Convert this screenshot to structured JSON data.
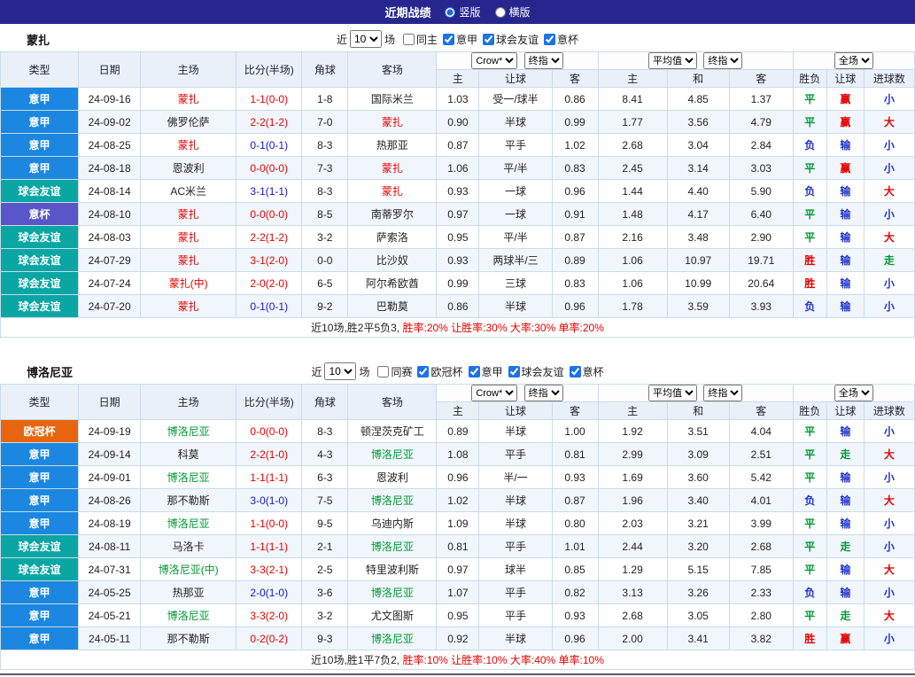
{
  "header": {
    "title": "近期战绩",
    "modes": [
      {
        "label": "竖版",
        "selected": true
      },
      {
        "label": "横版",
        "selected": false
      }
    ]
  },
  "table_headers": {
    "col_type": "类型",
    "col_date": "日期",
    "col_home": "主场",
    "col_score": "比分(半场)",
    "col_corner": "角球",
    "col_away": "客场",
    "col_h": "主",
    "col_handicap": "让球",
    "col_a": "客",
    "col_avg_h": "主",
    "col_avg_d": "和",
    "col_avg_a": "客",
    "col_wdl": "胜负",
    "col_hcp_result": "让球",
    "col_goals": "进球数"
  },
  "type_colors": {
    "意甲": "#1b87e0",
    "球会友谊": "#09a6a3",
    "意杯": "#5a55c8",
    "欧冠杯": "#e8650f"
  },
  "team_colors": {
    "red": "#e80000",
    "green": "#009933",
    "black": "#222222",
    "blue": "#1515cc"
  },
  "result_colors": {
    "胜": "#e80000",
    "赢": "#e80000",
    "大": "#e80000",
    "平": "#009933",
    "走": "#009933",
    "负": "#2233cc",
    "输": "#2233cc",
    "小": "#2233cc"
  },
  "sections": [
    {
      "team": "蒙扎",
      "filter": {
        "prefix": "近",
        "count": "10",
        "suffix": "场",
        "checkboxes": [
          {
            "label": "同主",
            "checked": false
          },
          {
            "label": "意甲",
            "checked": true
          },
          {
            "label": "球会友谊",
            "checked": true
          },
          {
            "label": "意杯",
            "checked": true
          }
        ]
      },
      "selects": {
        "source": "Crow*",
        "final1": "终指",
        "avg": "平均值",
        "final2": "终指",
        "scope": "全场"
      },
      "rows": [
        {
          "type": "意甲",
          "date": "24-09-16",
          "home": "蒙扎",
          "home_c": "red",
          "score": "1-1(0-0)",
          "score_c": "red",
          "corner": "1-8",
          "away": "国际米兰",
          "away_c": "black",
          "o1": "1.03",
          "hcp": "受一/球半",
          "o2": "0.86",
          "a1": "8.41",
          "a2": "4.85",
          "a3": "1.37",
          "r1": "平",
          "r2": "赢",
          "r3": "小"
        },
        {
          "type": "意甲",
          "date": "24-09-02",
          "home": "佛罗伦萨",
          "home_c": "black",
          "score": "2-2(1-2)",
          "score_c": "red",
          "corner": "7-0",
          "away": "蒙扎",
          "away_c": "red",
          "o1": "0.90",
          "hcp": "半球",
          "o2": "0.99",
          "a1": "1.77",
          "a2": "3.56",
          "a3": "4.79",
          "r1": "平",
          "r2": "赢",
          "r3": "大"
        },
        {
          "type": "意甲",
          "date": "24-08-25",
          "home": "蒙扎",
          "home_c": "red",
          "score": "0-1(0-1)",
          "score_c": "blue",
          "corner": "8-3",
          "away": "热那亚",
          "away_c": "black",
          "o1": "0.87",
          "hcp": "平手",
          "o2": "1.02",
          "a1": "2.68",
          "a2": "3.04",
          "a3": "2.84",
          "r1": "负",
          "r2": "输",
          "r3": "小"
        },
        {
          "type": "意甲",
          "date": "24-08-18",
          "home": "恩波利",
          "home_c": "black",
          "score": "0-0(0-0)",
          "score_c": "red",
          "corner": "7-3",
          "away": "蒙扎",
          "away_c": "red",
          "o1": "1.06",
          "hcp": "平/半",
          "o2": "0.83",
          "a1": "2.45",
          "a2": "3.14",
          "a3": "3.03",
          "r1": "平",
          "r2": "赢",
          "r3": "小"
        },
        {
          "type": "球会友谊",
          "date": "24-08-14",
          "home": "AC米兰",
          "home_c": "black",
          "score": "3-1(1-1)",
          "score_c": "blue",
          "corner": "8-3",
          "away": "蒙扎",
          "away_c": "red",
          "o1": "0.93",
          "hcp": "一球",
          "o2": "0.96",
          "a1": "1.44",
          "a2": "4.40",
          "a3": "5.90",
          "r1": "负",
          "r2": "输",
          "r3": "大"
        },
        {
          "type": "意杯",
          "date": "24-08-10",
          "home": "蒙扎",
          "home_c": "red",
          "score": "0-0(0-0)",
          "score_c": "red",
          "corner": "8-5",
          "away": "南蒂罗尔",
          "away_c": "black",
          "o1": "0.97",
          "hcp": "一球",
          "o2": "0.91",
          "a1": "1.48",
          "a2": "4.17",
          "a3": "6.40",
          "r1": "平",
          "r2": "输",
          "r3": "小"
        },
        {
          "type": "球会友谊",
          "date": "24-08-03",
          "home": "蒙扎",
          "home_c": "red",
          "score": "2-2(1-2)",
          "score_c": "red",
          "corner": "3-2",
          "away": "萨索洛",
          "away_c": "black",
          "o1": "0.95",
          "hcp": "平/半",
          "o2": "0.87",
          "a1": "2.16",
          "a2": "3.48",
          "a3": "2.90",
          "r1": "平",
          "r2": "输",
          "r3": "大"
        },
        {
          "type": "球会友谊",
          "date": "24-07-29",
          "home": "蒙扎",
          "home_c": "red",
          "score": "3-1(2-0)",
          "score_c": "red",
          "corner": "0-0",
          "away": "比沙奴",
          "away_c": "black",
          "o1": "0.93",
          "hcp": "两球半/三",
          "o2": "0.89",
          "a1": "1.06",
          "a2": "10.97",
          "a3": "19.71",
          "r1": "胜",
          "r2": "输",
          "r3": "走"
        },
        {
          "type": "球会友谊",
          "date": "24-07-24",
          "home": "蒙扎(中)",
          "home_c": "red",
          "score": "2-0(2-0)",
          "score_c": "red",
          "corner": "6-5",
          "away": "阿尔希欧酋",
          "away_c": "black",
          "o1": "0.99",
          "hcp": "三球",
          "o2": "0.83",
          "a1": "1.06",
          "a2": "10.99",
          "a3": "20.64",
          "r1": "胜",
          "r2": "输",
          "r3": "小"
        },
        {
          "type": "球会友谊",
          "date": "24-07-20",
          "home": "蒙扎",
          "home_c": "red",
          "score": "0-1(0-1)",
          "score_c": "blue",
          "corner": "9-2",
          "away": "巴勒莫",
          "away_c": "black",
          "o1": "0.86",
          "hcp": "半球",
          "o2": "0.96",
          "a1": "1.78",
          "a2": "3.59",
          "a3": "3.93",
          "r1": "负",
          "r2": "输",
          "r3": "小"
        }
      ],
      "summary": {
        "prefix": "近10场,胜2平5负3,",
        "stats": "胜率:20% 让胜率:30% 大率:30% 单率:20%"
      }
    },
    {
      "team": "博洛尼亚",
      "filter": {
        "prefix": "近",
        "count": "10",
        "suffix": "场",
        "checkboxes": [
          {
            "label": "同赛",
            "checked": false
          },
          {
            "label": "欧冠杯",
            "checked": true
          },
          {
            "label": "意甲",
            "checked": true
          },
          {
            "label": "球会友谊",
            "checked": true
          },
          {
            "label": "意杯",
            "checked": true
          }
        ]
      },
      "selects": {
        "source": "Crow*",
        "final1": "终指",
        "avg": "平均值",
        "final2": "终指",
        "scope": "全场"
      },
      "rows": [
        {
          "type": "欧冠杯",
          "date": "24-09-19",
          "home": "博洛尼亚",
          "home_c": "green",
          "score": "0-0(0-0)",
          "score_c": "red",
          "corner": "8-3",
          "away": "顿涅茨克矿工",
          "away_c": "black",
          "o1": "0.89",
          "hcp": "半球",
          "o2": "1.00",
          "a1": "1.92",
          "a2": "3.51",
          "a3": "4.04",
          "r1": "平",
          "r2": "输",
          "r3": "小"
        },
        {
          "type": "意甲",
          "date": "24-09-14",
          "home": "科莫",
          "home_c": "black",
          "score": "2-2(1-0)",
          "score_c": "red",
          "corner": "4-3",
          "away": "博洛尼亚",
          "away_c": "green",
          "o1": "1.08",
          "hcp": "平手",
          "o2": "0.81",
          "a1": "2.99",
          "a2": "3.09",
          "a3": "2.51",
          "r1": "平",
          "r2": "走",
          "r3": "大"
        },
        {
          "type": "意甲",
          "date": "24-09-01",
          "home": "博洛尼亚",
          "home_c": "green",
          "score": "1-1(1-1)",
          "score_c": "red",
          "corner": "6-3",
          "away": "恩波利",
          "away_c": "black",
          "o1": "0.96",
          "hcp": "半/一",
          "o2": "0.93",
          "a1": "1.69",
          "a2": "3.60",
          "a3": "5.42",
          "r1": "平",
          "r2": "输",
          "r3": "小"
        },
        {
          "type": "意甲",
          "date": "24-08-26",
          "home": "那不勒斯",
          "home_c": "black",
          "score": "3-0(1-0)",
          "score_c": "blue",
          "corner": "7-5",
          "away": "博洛尼亚",
          "away_c": "green",
          "o1": "1.02",
          "hcp": "半球",
          "o2": "0.87",
          "a1": "1.96",
          "a2": "3.40",
          "a3": "4.01",
          "r1": "负",
          "r2": "输",
          "r3": "大"
        },
        {
          "type": "意甲",
          "date": "24-08-19",
          "home": "博洛尼亚",
          "home_c": "green",
          "score": "1-1(0-0)",
          "score_c": "red",
          "corner": "9-5",
          "away": "乌迪内斯",
          "away_c": "black",
          "o1": "1.09",
          "hcp": "半球",
          "o2": "0.80",
          "a1": "2.03",
          "a2": "3.21",
          "a3": "3.99",
          "r1": "平",
          "r2": "输",
          "r3": "小"
        },
        {
          "type": "球会友谊",
          "date": "24-08-11",
          "home": "马洛卡",
          "home_c": "black",
          "score": "1-1(1-1)",
          "score_c": "red",
          "corner": "2-1",
          "away": "博洛尼亚",
          "away_c": "green",
          "o1": "0.81",
          "hcp": "平手",
          "o2": "1.01",
          "a1": "2.44",
          "a2": "3.20",
          "a3": "2.68",
          "r1": "平",
          "r2": "走",
          "r3": "小"
        },
        {
          "type": "球会友谊",
          "date": "24-07-31",
          "home": "博洛尼亚(中)",
          "home_c": "green",
          "score": "3-3(2-1)",
          "score_c": "red",
          "corner": "2-5",
          "away": "特里波利斯",
          "away_c": "black",
          "o1": "0.97",
          "hcp": "球半",
          "o2": "0.85",
          "a1": "1.29",
          "a2": "5.15",
          "a3": "7.85",
          "r1": "平",
          "r2": "输",
          "r3": "大"
        },
        {
          "type": "意甲",
          "date": "24-05-25",
          "home": "热那亚",
          "home_c": "black",
          "score": "2-0(1-0)",
          "score_c": "blue",
          "corner": "3-6",
          "away": "博洛尼亚",
          "away_c": "green",
          "o1": "1.07",
          "hcp": "平手",
          "o2": "0.82",
          "a1": "3.13",
          "a2": "3.26",
          "a3": "2.33",
          "r1": "负",
          "r2": "输",
          "r3": "小"
        },
        {
          "type": "意甲",
          "date": "24-05-21",
          "home": "博洛尼亚",
          "home_c": "green",
          "score": "3-3(2-0)",
          "score_c": "red",
          "corner": "3-2",
          "away": "尤文图斯",
          "away_c": "black",
          "o1": "0.95",
          "hcp": "平手",
          "o2": "0.93",
          "a1": "2.68",
          "a2": "3.05",
          "a3": "2.80",
          "r1": "平",
          "r2": "走",
          "r3": "大"
        },
        {
          "type": "意甲",
          "date": "24-05-11",
          "home": "那不勒斯",
          "home_c": "black",
          "score": "0-2(0-2)",
          "score_c": "red",
          "corner": "9-3",
          "away": "博洛尼亚",
          "away_c": "green",
          "o1": "0.92",
          "hcp": "半球",
          "o2": "0.96",
          "a1": "2.00",
          "a2": "3.41",
          "a3": "3.82",
          "r1": "胜",
          "r2": "赢",
          "r3": "小"
        }
      ],
      "summary": {
        "prefix": "近10场,胜1平7负2,",
        "stats": "胜率:10% 让胜率:10% 大率:40% 单率:10%"
      }
    }
  ]
}
